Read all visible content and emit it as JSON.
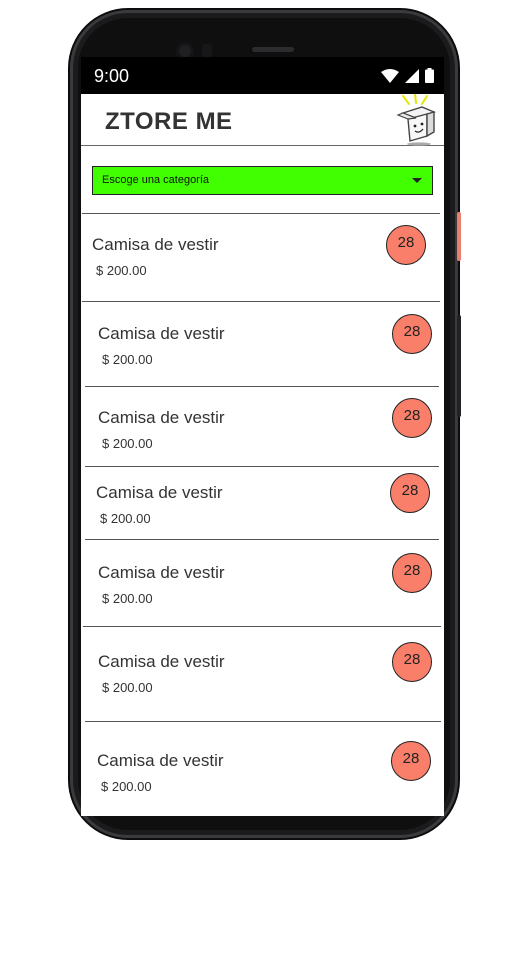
{
  "status_bar": {
    "time": "9:00",
    "icons": [
      "wifi-icon",
      "signal-icon",
      "battery-icon"
    ]
  },
  "app": {
    "title": "ZTORE ME",
    "logo_icon": "box-mascot-icon"
  },
  "category_select": {
    "selected": "Escoge una categoría",
    "icon": "caret-down-icon",
    "bg_color": "#41ff00"
  },
  "products": [
    {
      "name": "Camisa de vestir",
      "price": "$ 200.00",
      "badge": "28"
    },
    {
      "name": "Camisa de vestir",
      "price": "$ 200.00",
      "badge": "28"
    },
    {
      "name": "Camisa de vestir",
      "price": "$ 200.00",
      "badge": "28"
    },
    {
      "name": "Camisa de vestir",
      "price": "$ 200.00",
      "badge": "28"
    },
    {
      "name": "Camisa de vestir",
      "price": "$ 200.00",
      "badge": "28"
    },
    {
      "name": "Camisa de vestir",
      "price": "$ 200.00",
      "badge": "28"
    },
    {
      "name": "Camisa de vestir",
      "price": "$ 200.00",
      "badge": "28"
    }
  ],
  "colors": {
    "badge": "#fa7f6a",
    "accent": "#41ff00"
  }
}
